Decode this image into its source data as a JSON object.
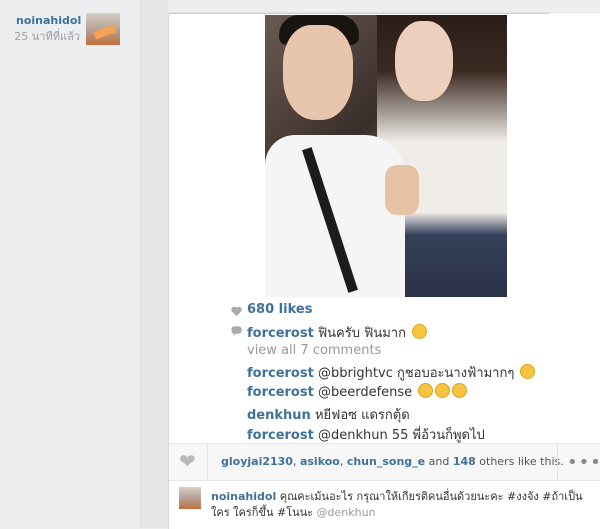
{
  "author": {
    "username": "noinahidol",
    "time_ago": "25 นาทีที่แล้ว"
  },
  "post": {
    "likes_text": "680 likes",
    "comments": [
      {
        "user": "forcerost",
        "text": "ฟินครับ ฟินมาก",
        "emoji": 1
      },
      {
        "user": "forcerost",
        "text": "@bbrightvc กูชอบอะนางฟ้ามากๆ",
        "emoji": 1
      },
      {
        "user": "forcerost",
        "text": "@beerdefense",
        "emoji": 3
      },
      {
        "user": "denkhun",
        "text": "หยีฟอซ แดรกตุ้ด",
        "emoji": 0
      },
      {
        "user": "forcerost",
        "text": "@denkhun 55 พี่อ้วนก็พูดไป",
        "emoji": 0
      }
    ],
    "view_all_label": "view all 7 comments"
  },
  "action_bar": {
    "likers": [
      "gloyjai2130",
      "asikoo",
      "chun_song_e"
    ],
    "and_label": "and",
    "others_count": "148",
    "others_label": "others like this."
  },
  "caption": {
    "username": "noinahidol",
    "text": "คุณคะเม้นอะไร กรุณาให้เกียรติคนอื่นด้วยนะคะ #งงจัง #ถ้าเป็นใคร ใครก็ขึ้น #โนนะ",
    "mention": "@denkhun"
  },
  "colors": {
    "link": "#3f729b",
    "background": "#edeeef"
  }
}
